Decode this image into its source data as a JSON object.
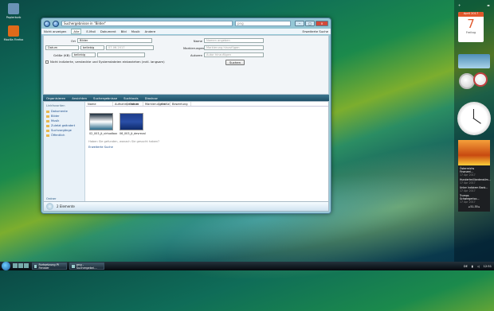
{
  "desktop": {
    "icons": [
      {
        "label": "Papierkorb",
        "name": "recycle-bin-icon",
        "color": "#6a93b5"
      },
      {
        "label": "Mozilla Firefox",
        "name": "firefox-icon",
        "color": "#e06a1a"
      }
    ]
  },
  "window": {
    "title": "Suchergebnisse in \"Bilder\"",
    "search_value": "png",
    "controls": {
      "minimize": "–",
      "maximize": "□",
      "close": "×"
    },
    "menu": [
      "Nicht anzeigen",
      "Alle",
      "E-Mail",
      "Dokument",
      "Bild",
      "Musik",
      "Andere"
    ],
    "menu_active": "Alle",
    "advanced": "Erweiterte Suche",
    "criteria": {
      "ort_label": "Ort",
      "ort_value": "Bilder",
      "datum_value": "Datum",
      "datum_mode": "beliebig",
      "datum_date": "07.06.2017",
      "groesse_label": "Größe (KB)",
      "groesse_mode": "beliebig",
      "checkbox": "Nicht indizierte, versteckte und Systemdateien einbeziehen (evtl. langsam)",
      "name_label": "Name",
      "name_ph": "Namen angeben",
      "markierungen_label": "Markierungen",
      "markierungen_ph": "Markierung hinzufügen",
      "autoren_label": "Autoren",
      "autoren_ph": "Autor hinzufügen",
      "search_btn": "Suchen"
    },
    "toolbar": [
      "Organisieren",
      "Ansichten",
      "Suchergebnisse",
      "Suchtools",
      "Diashow"
    ],
    "sidebar": {
      "heading": "Linkfavoriten",
      "items": [
        "Dokumente",
        "Bilder",
        "Musik",
        "Zuletzt geändert",
        "Suchvorgänge",
        "Öffentlich"
      ],
      "folders": "Ordner"
    },
    "columns": [
      "Name",
      "Aufnahmedatum",
      "Ordner",
      "Markierungen",
      "Größe",
      "Bewertung"
    ],
    "files": [
      {
        "name": "02_003_jt_virtualbox",
        "colors": [
          "#1a2a3a",
          "#ffffff",
          "#2a6a8a"
        ]
      },
      {
        "name": "06_003_jt_devrevol",
        "colors": [
          "#1d3c8a",
          "#2a4fa8",
          "#0e2a6a"
        ]
      }
    ],
    "hint": "Haben Sie gefunden, wonach Sie gesucht haben?",
    "hint_link": "Erweiterte Suche",
    "status": "2 Elemente"
  },
  "gadgets": {
    "calendar": {
      "month": "April 2017",
      "day": "7",
      "weekday": "Freitag"
    },
    "feeds": [
      {
        "title": "Österreichs Finanzmi...",
        "date": "17 Apr 2017"
      },
      {
        "title": "Hundertmilliardenstlm...",
        "date": "17 Apr 2017"
      },
      {
        "title": "Unter Indiziem Bank...",
        "date": "17 Apr 2017"
      },
      {
        "title": "Trumps Schwiegertoc...",
        "date": "17 Apr 2017"
      }
    ],
    "feed_nav": "◂ 51-55 ▸"
  },
  "taskbar": {
    "items": [
      "Fortsetzung Pi Fenster",
      "png - Suchergebni..."
    ],
    "tray": {
      "lang": "DE",
      "time": "12:51"
    }
  }
}
